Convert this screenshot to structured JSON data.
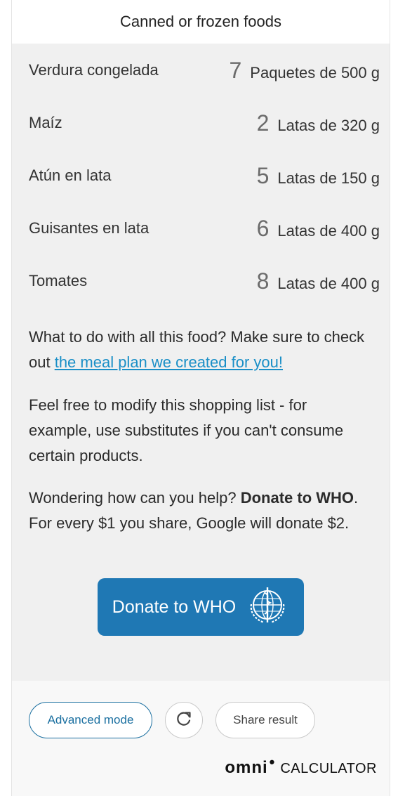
{
  "section": {
    "title": "Canned or frozen foods"
  },
  "items": [
    {
      "name": "Verdura congelada",
      "qty": "7",
      "unit": "Paquetes de 500 g"
    },
    {
      "name": "Maíz",
      "qty": "2",
      "unit": "Latas de 320 g"
    },
    {
      "name": "Atún en lata",
      "qty": "5",
      "unit": "Latas de 150 g"
    },
    {
      "name": "Guisantes en lata",
      "qty": "6",
      "unit": "Latas de 400 g"
    },
    {
      "name": "Tomates",
      "qty": "8",
      "unit": "Latas de 400 g"
    }
  ],
  "meal": {
    "text": "What to do with all this food? Make sure to check out ",
    "link": "the meal plan we created for you!"
  },
  "modify": {
    "text": "Feel free to modify this shopping list - for example, use substitutes if you can't consume certain products."
  },
  "help": {
    "prefix": "Wondering how can you help? ",
    "bold": "Donate to WHO",
    "suffix": ". For every $1 you share, Google will donate $2."
  },
  "donate": {
    "label": "Donate to WHO",
    "icon": "who-emblem-icon"
  },
  "footer": {
    "advanced_label": "Advanced mode",
    "reload_icon": "reload-icon",
    "share_label": "Share result",
    "logo_omni": "omni",
    "logo_calc": "CALCULATOR"
  },
  "colors": {
    "accent": "#1f78b4",
    "link": "#1a8fc7",
    "panel_bg": "#f0f0f0",
    "outline": "#1a6fa0"
  }
}
